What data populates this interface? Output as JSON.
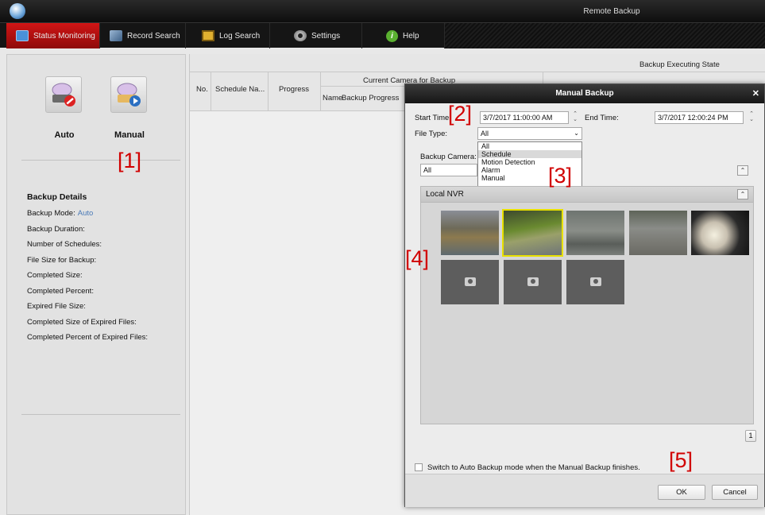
{
  "window": {
    "title": "Remote Backup"
  },
  "nav": {
    "tabs": [
      {
        "label": "Status Monitoring",
        "active": true
      },
      {
        "label": "Record Search"
      },
      {
        "label": "Log Search"
      },
      {
        "label": "Settings"
      },
      {
        "label": "Help"
      }
    ]
  },
  "left": {
    "auto_label": "Auto",
    "manual_label": "Manual",
    "details": {
      "header": "Backup Details",
      "rows": [
        {
          "label": "Backup Mode:",
          "value": "Auto"
        },
        {
          "label": "Backup Duration:"
        },
        {
          "label": "Number of Schedules:"
        },
        {
          "label": "File Size for Backup:"
        },
        {
          "label": "Completed Size:"
        },
        {
          "label": "Completed Percent:"
        },
        {
          "label": "Expired File Size:"
        },
        {
          "label": "Completed Size of Expired Files:"
        },
        {
          "label": "Completed Percent of Expired Files:"
        }
      ]
    }
  },
  "table": {
    "group_header": "Backup Executing State",
    "col_no": "No.",
    "col_schedule": "Schedule Na...",
    "col_progress": "Progress",
    "current_camera": "Current Camera for Backup",
    "sub_name": "Name",
    "sub_progress": "Backup Progress"
  },
  "dialog": {
    "title": "Manual Backup",
    "start_time_label": "Start Time:",
    "start_time_value": "3/7/2017 11:00:00 AM",
    "end_time_label": "End Time:",
    "end_time_value": "3/7/2017 12:00:24 PM",
    "file_type_label": "File Type:",
    "file_type_value": "All",
    "file_type_options": [
      "All",
      "Schedule",
      "Motion Detection",
      "Alarm",
      "Manual"
    ],
    "backup_camera_label": "Backup Camera:",
    "backup_camera_value": "All",
    "group_name": "Local NVR",
    "page_number": "1",
    "auto_switch_label": "Switch to Auto Backup mode when the Manual Backup finishes.",
    "ok_label": "OK",
    "cancel_label": "Cancel"
  },
  "markers": [
    "[1]",
    "[2]",
    "[3]",
    "[4]",
    "[5]"
  ],
  "colors": {
    "accent_red": "#c01010",
    "selection_yellow": "#e8e000",
    "link_blue": "#4a7ab7"
  }
}
